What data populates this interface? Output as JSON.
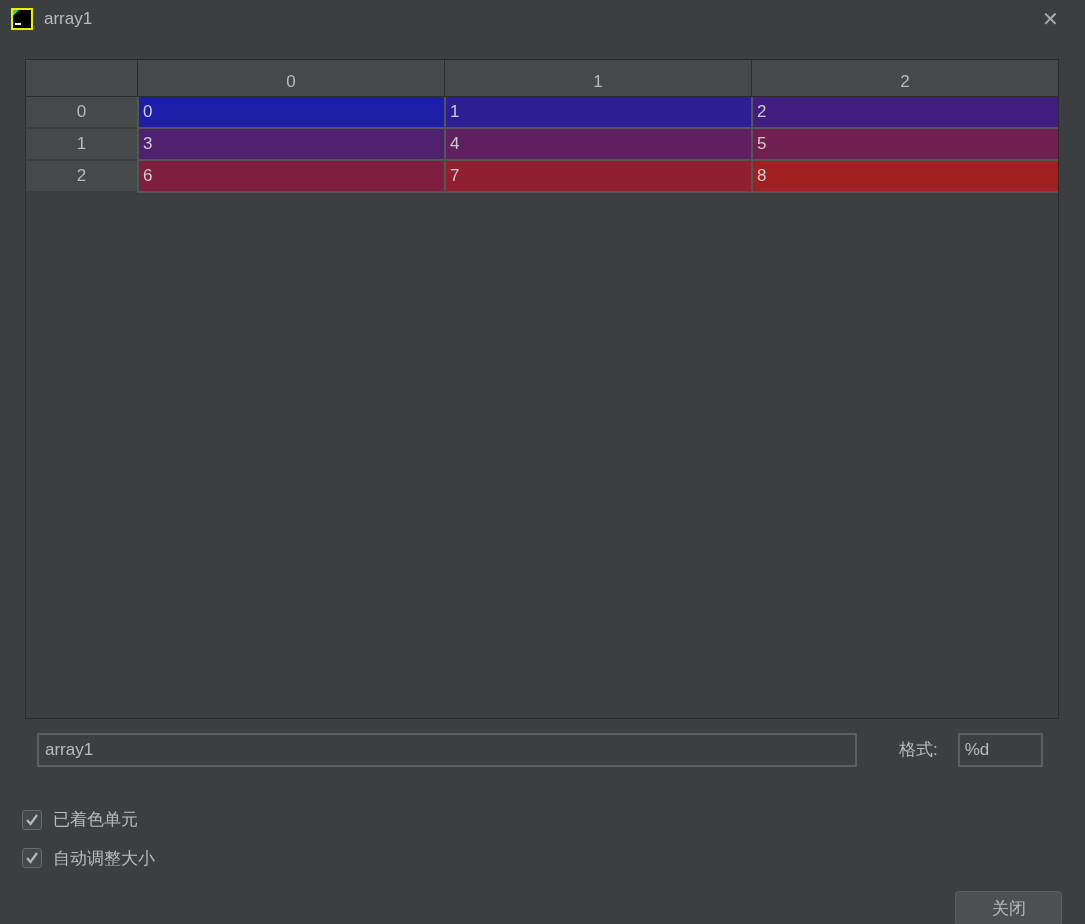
{
  "window": {
    "title": "array1",
    "close": "✕"
  },
  "table": {
    "columns": [
      "0",
      "1",
      "2"
    ],
    "rows": [
      {
        "header": "0",
        "cells": [
          {
            "text": "0",
            "color": "#1c1ea8"
          },
          {
            "text": "1",
            "color": "#2d1e93"
          },
          {
            "text": "2",
            "color": "#3f1e80"
          }
        ]
      },
      {
        "header": "1",
        "cells": [
          {
            "text": "3",
            "color": "#4f1f70"
          },
          {
            "text": "4",
            "color": "#5f1f60"
          },
          {
            "text": "5",
            "color": "#6f1f50"
          }
        ]
      },
      {
        "header": "2",
        "cells": [
          {
            "text": "6",
            "color": "#7f1f40"
          },
          {
            "text": "7",
            "color": "#901f30"
          },
          {
            "text": "8",
            "color": "#a01f20"
          }
        ]
      }
    ]
  },
  "name_field": {
    "value": "array1"
  },
  "format": {
    "label": "格式:",
    "value": "%d"
  },
  "checkboxes": [
    {
      "label": "已着色单元",
      "checked": true
    },
    {
      "label": "自动调整大小",
      "checked": true
    }
  ],
  "close_button": "关闭"
}
